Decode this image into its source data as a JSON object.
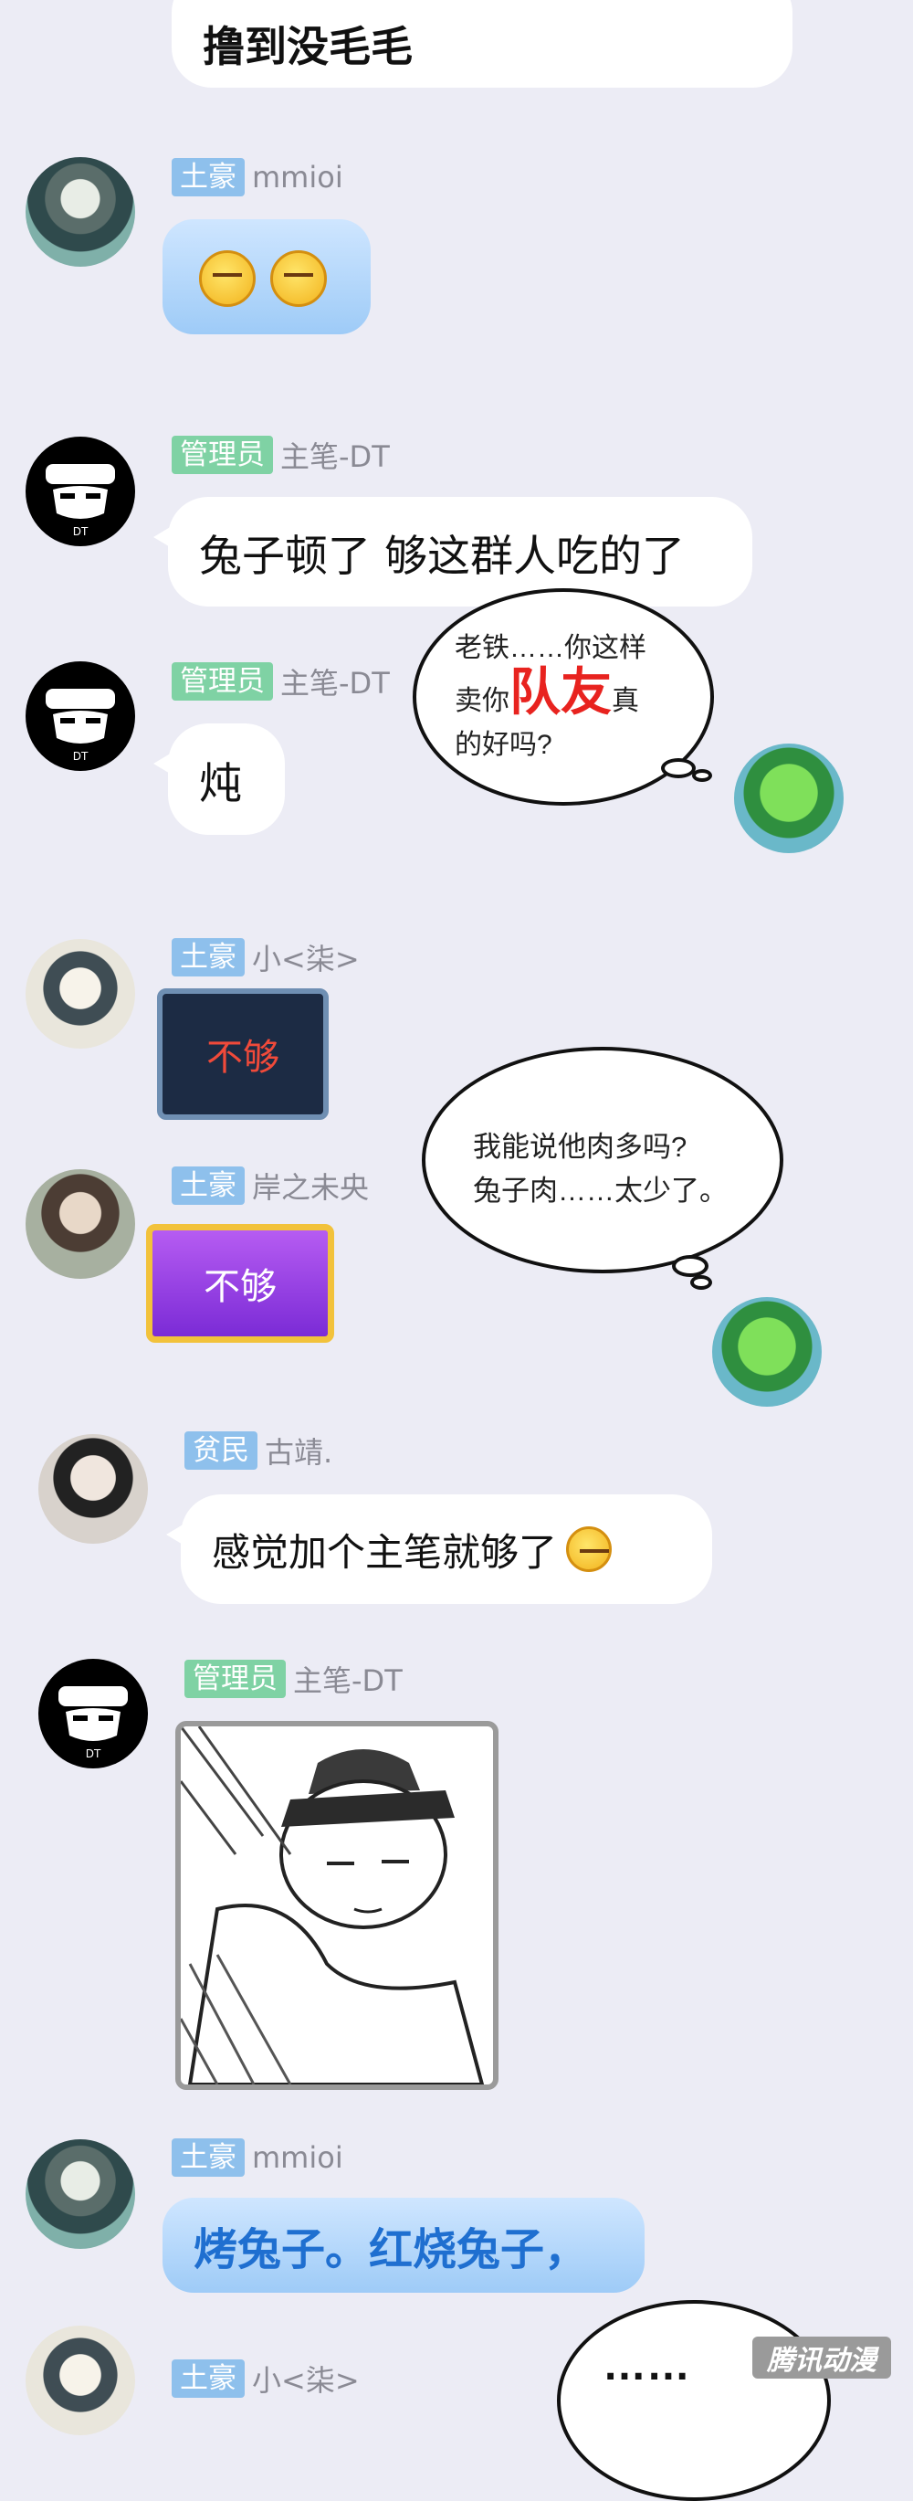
{
  "messages": {
    "m0": {
      "text": "撸到没毛毛"
    },
    "m1": {
      "role": "土豪",
      "user": "mmioi"
    },
    "m2": {
      "role": "管理员",
      "user": "主笔-DT",
      "text": "兔子顿了 够这群人吃的了"
    },
    "m3": {
      "role": "管理员",
      "user": "主笔-DT",
      "text": "炖"
    },
    "m4": {
      "role": "土豪",
      "user": "小<柒>",
      "sticker": "不够"
    },
    "m5": {
      "role": "土豪",
      "user": "岸之未央",
      "sticker": "不够"
    },
    "m6": {
      "role": "贫民",
      "user": "古靖.",
      "text": "感觉加个主笔就够了"
    },
    "m7": {
      "role": "管理员",
      "user": "主笔-DT"
    },
    "m8": {
      "role": "土豪",
      "user": "mmioi",
      "text": "烤兔子。红烧兔子，"
    },
    "m9": {
      "role": "土豪",
      "user": "小<柒>"
    }
  },
  "thoughts": {
    "t1": {
      "line1": "老铁……你这样",
      "line2a": "卖你",
      "emph": "队友",
      "line2b": "真",
      "line3": "的好吗?"
    },
    "t2": {
      "line1": "我能说他肉多吗?",
      "line2": "兔子肉……太少了。"
    },
    "t3": {
      "text": "……"
    }
  },
  "watermark": {
    "text": "腾讯动漫"
  },
  "colors": {
    "accent_red": "#e8231f",
    "bubble_blue": "#9ecbf7",
    "admin_badge": "#7fd2a4",
    "tuhao_badge": "#8ec0ec"
  }
}
